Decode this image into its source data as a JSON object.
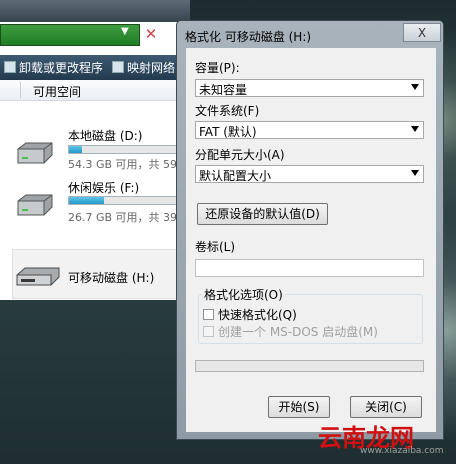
{
  "explorer": {
    "toolbar": {
      "uninstall_label": "卸载或更改程序",
      "map_label": "映射网络"
    },
    "column_header": "可用空间",
    "drives": [
      {
        "name": "本地磁盘 (D:)",
        "info": "54.3 GB 可用，共 59.",
        "usage": 0.12
      },
      {
        "name": "休闲娱乐 (F:)",
        "info": "26.7 GB 可用，共 39.",
        "usage": 0.32
      },
      {
        "name": "可移动磁盘 (H:)"
      }
    ]
  },
  "dialog": {
    "title": "格式化 可移动磁盘 (H:)",
    "close_label": "X",
    "capacity_label": "容量(P):",
    "capacity_value": "未知容量",
    "filesystem_label": "文件系统(F)",
    "filesystem_value": "FAT (默认)",
    "alloc_label": "分配单元大小(A)",
    "alloc_value": "默认配置大小",
    "restore_button": "还原设备的默认值(D)",
    "volume_label": "卷标(L)",
    "volume_value": "",
    "options_title": "格式化选项(O)",
    "quick_format": "快速格式化(Q)",
    "msdos_disk": "创建一个 MS-DOS 启动盘(M)",
    "start_button": "开始(S)",
    "close_button": "关闭(C)"
  },
  "watermark": {
    "brand": "云南龙网",
    "url": "www.xiazaiba.com"
  }
}
